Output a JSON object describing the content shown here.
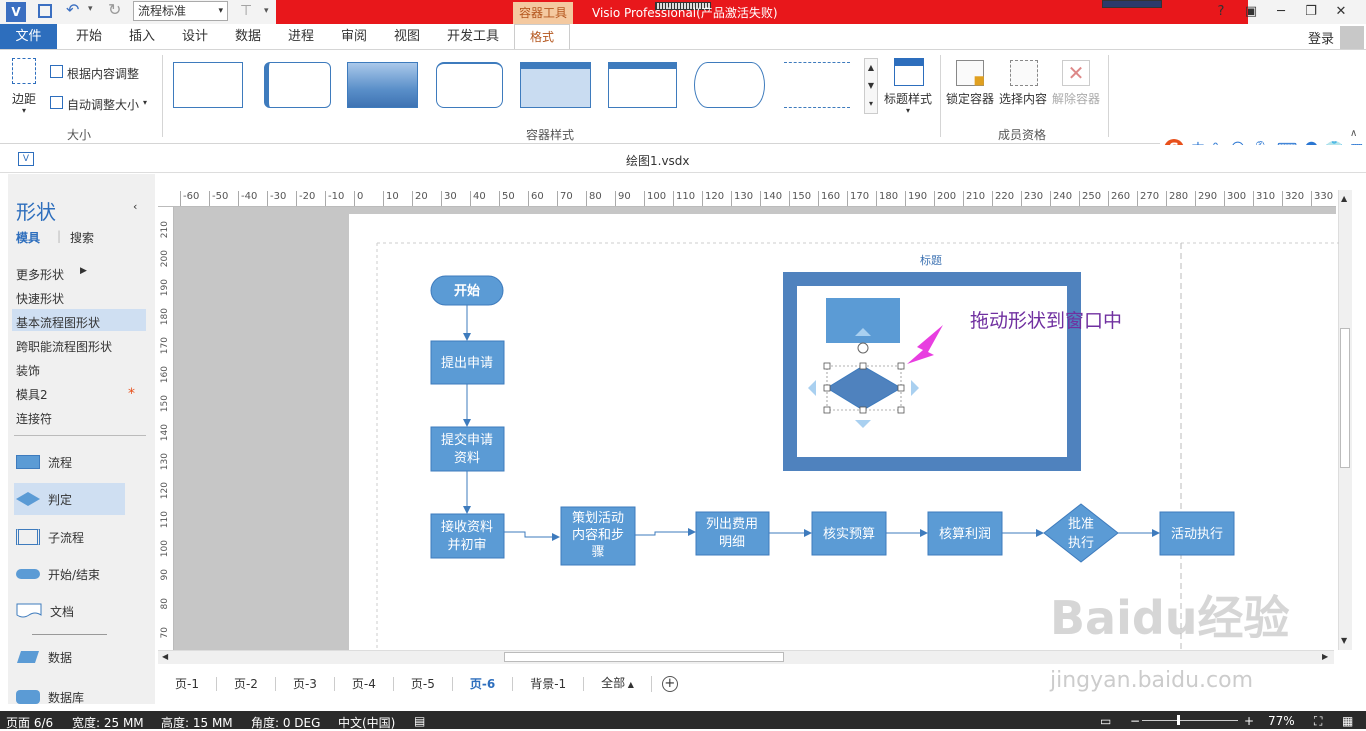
{
  "window": {
    "app_title": "Visio Professional(产品激活失败)",
    "context_tab": "容器工具",
    "qat_combo_value": "流程标准",
    "login": "登录"
  },
  "tabs": [
    "开始",
    "插入",
    "设计",
    "数据",
    "进程",
    "审阅",
    "视图",
    "开发工具"
  ],
  "file_tab": "文件",
  "format_tab": "格式",
  "ribbon": {
    "size_group": {
      "margins": "边距",
      "fit_content": "根据内容调整",
      "auto_resize": "自动调整大小",
      "label": "大小"
    },
    "style_group": {
      "label": "容器样式",
      "heading_style": "标题样式"
    },
    "member_group": {
      "lock": "锁定容器",
      "select": "选择内容",
      "disband": "解除容器",
      "label": "成员资格"
    }
  },
  "ime": {
    "mode": "中"
  },
  "document": {
    "name": "绘图1.vsdx"
  },
  "shapes_pane": {
    "title": "形状",
    "tab_stencils": "模具",
    "tab_search": "搜索",
    "items": [
      "更多形状",
      "快速形状",
      "基本流程图形状",
      "跨职能流程图形状",
      "装饰",
      "模具2",
      "连接符"
    ],
    "shapes": [
      "流程",
      "判定",
      "子流程",
      "开始/结束",
      "文档",
      "数据",
      "数据库"
    ]
  },
  "ruler_h": [
    "-60",
    "-50",
    "-40",
    "-30",
    "-20",
    "-10",
    "0",
    "10",
    "20",
    "30",
    "40",
    "50",
    "60",
    "70",
    "80",
    "90",
    "100",
    "110",
    "120",
    "130",
    "140",
    "150",
    "160",
    "170",
    "180",
    "190",
    "200",
    "210",
    "220",
    "230",
    "240",
    "250",
    "260",
    "270",
    "280",
    "290",
    "300",
    "310",
    "320",
    "330"
  ],
  "ruler_v": [
    "210",
    "200",
    "190",
    "180",
    "170",
    "160",
    "150",
    "140",
    "130",
    "120",
    "110",
    "100",
    "90",
    "80",
    "70"
  ],
  "diagram": {
    "start": "开始",
    "step1": "提出申请",
    "step2": "提交申请资料",
    "step3": "接收资料并初审",
    "step4": "策划活动内容和步骤",
    "step5": "列出费用明细",
    "step6": "核实预算",
    "step7": "核算利润",
    "decision": "批准执行",
    "step8": "活动执行",
    "container_title": "标题",
    "annotation": "拖动形状到窗口中"
  },
  "page_tabs": [
    "页-1",
    "页-2",
    "页-3",
    "页-4",
    "页-5",
    "页-6",
    "背景-1",
    "全部"
  ],
  "active_page": "页-6",
  "status": {
    "page": "页面 6/6",
    "width": "宽度: 25 MM",
    "height": "高度: 15 MM",
    "angle": "角度: 0 DEG",
    "lang": "中文(中国)",
    "zoom": "77%"
  },
  "watermark": {
    "logo": "Baidu经验",
    "url": "jingyan.baidu.com"
  },
  "colors": {
    "accent": "#2d6ebd",
    "shape_fill": "#5b9bd5",
    "titlebar_red": "#e8171b",
    "annotation": "#7030a0",
    "arrow_magenta": "#e83ee0"
  }
}
